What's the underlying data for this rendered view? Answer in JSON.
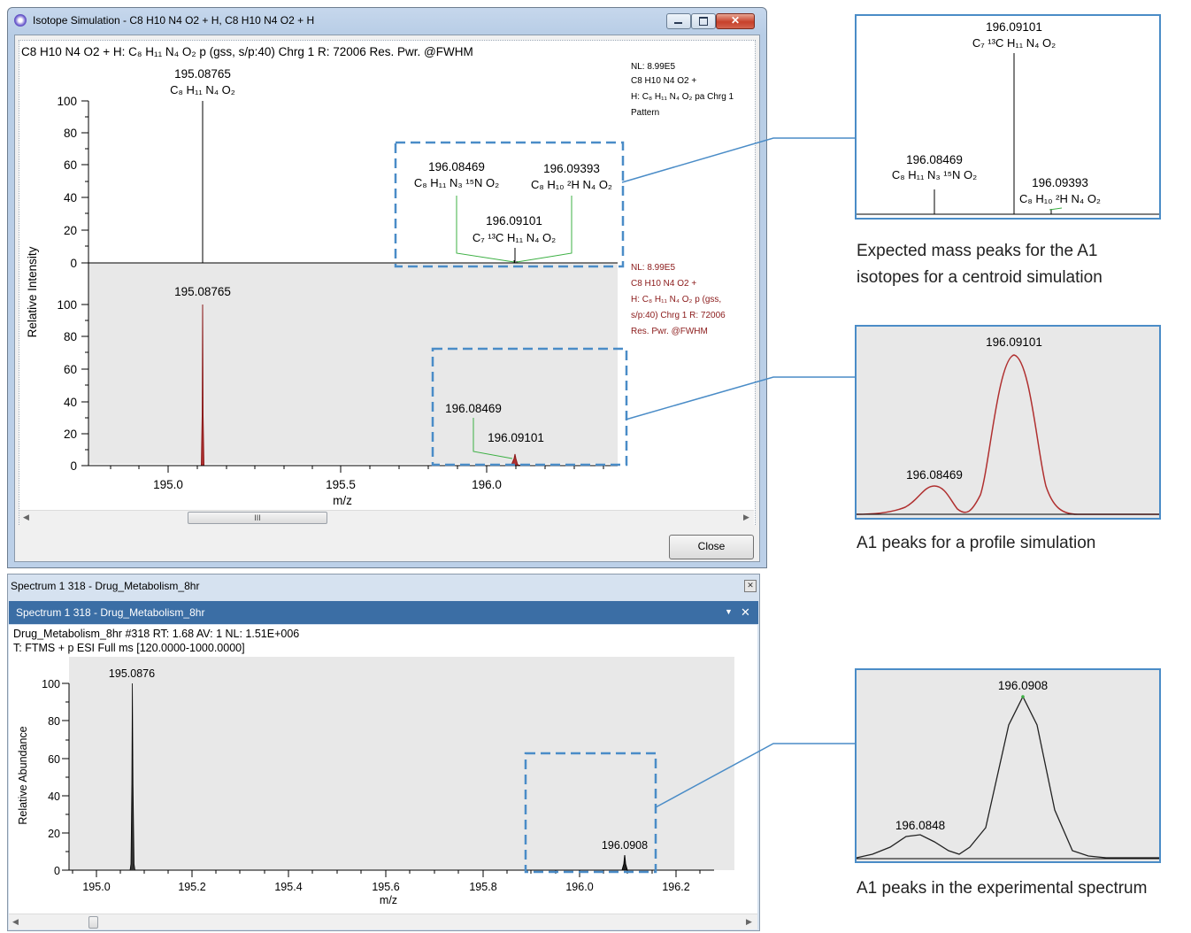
{
  "window1": {
    "title": "Isotope Simulation - C8 H10 N4 O2 + H, C8 H10 N4 O2 + H",
    "header": "C8 H10 N4 O2 + H: C₈ H₁₁ N₄ O₂   p (gss, s/p:40) Chrg 1 R: 72006 Res. Pwr. @FWHM",
    "top_note": [
      "NL: 8.99E5",
      "C8 H10 N4 O2 +",
      "H: C₈ H₁₁ N₄ O₂  pa Chrg 1",
      "Pattern"
    ],
    "bottom_note": [
      "NL: 8.99E5",
      "C8 H10 N4 O2 +",
      "H: C₈ H₁₁ N₄ O₂   p (gss,",
      "s/p:40) Chrg 1 R: 72006",
      "Res. Pwr. @FWHM"
    ],
    "y_axis_label": "Relative Intensity",
    "x_axis_label": "m/z",
    "y_ticks": [
      "100",
      "80",
      "60",
      "40",
      "20",
      "0"
    ],
    "x_ticks": [
      "195.0",
      "195.5",
      "196.0"
    ],
    "top_peaks": {
      "main_mass": "195.08765",
      "main_formula": "C₈ H₁₁ N₄ O₂",
      "a_mass": "196.08469",
      "a_formula": "C₈ H₁₁ N₃ ¹⁵N O₂",
      "b_mass": "196.09393",
      "b_formula": "C₈ H₁₀ ²H N₄ O₂",
      "c_mass": "196.09101",
      "c_formula": "C₇ ¹³C H₁₁ N₄ O₂"
    },
    "bottom_peaks": {
      "main_mass": "195.08765",
      "a_mass": "196.08469",
      "c_mass": "196.09101"
    },
    "scroll_thumb_label": "III",
    "close_button": "Close"
  },
  "window2": {
    "outer_title": "Spectrum 1  318 - Drug_Metabolism_8hr",
    "inner_title": "Spectrum 1  318 - Drug_Metabolism_8hr",
    "header_line1": "Drug_Metabolism_8hr #318 RT: 1.68 AV: 1 NL: 1.51E+006",
    "header_line2": "T: FTMS + p ESI Full ms [120.0000-1000.0000]",
    "y_axis_label": "Relative Abundance",
    "x_axis_label": "m/z",
    "y_ticks": [
      "100",
      "80",
      "60",
      "40",
      "20",
      "0"
    ],
    "x_ticks": [
      "195.0",
      "195.2",
      "195.4",
      "195.6",
      "195.8",
      "196.0",
      "196.2"
    ],
    "peak1": "195.0876",
    "peak2": "196.0908",
    "pin_glyph": "▼",
    "close_glyph": "✕"
  },
  "zoom1": {
    "top_mass": "196.09101",
    "top_formula": "C₇ ¹³C H₁₁ N₄ O₂",
    "left_mass": "196.08469",
    "left_formula": "C₈ H₁₁ N₃ ¹⁵N O₂",
    "right_mass": "196.09393",
    "right_formula": "C₈ H₁₀ ²H N₄ O₂",
    "caption_line1": "Expected mass peaks for the A1",
    "caption_line2": "isotopes for a centroid simulation"
  },
  "zoom2": {
    "top_mass": "196.09101",
    "left_mass": "196.08469",
    "caption": "A1 peaks for a profile simulation"
  },
  "zoom3": {
    "top_mass": "196.0908",
    "left_mass": "196.0848",
    "caption": "A1 peaks in the experimental spectrum"
  },
  "colors": {
    "callout_blue": "#4a8cc7",
    "profile_red": "#b03030",
    "label_green": "#3cb043",
    "note_red": "#8b1a1a"
  }
}
